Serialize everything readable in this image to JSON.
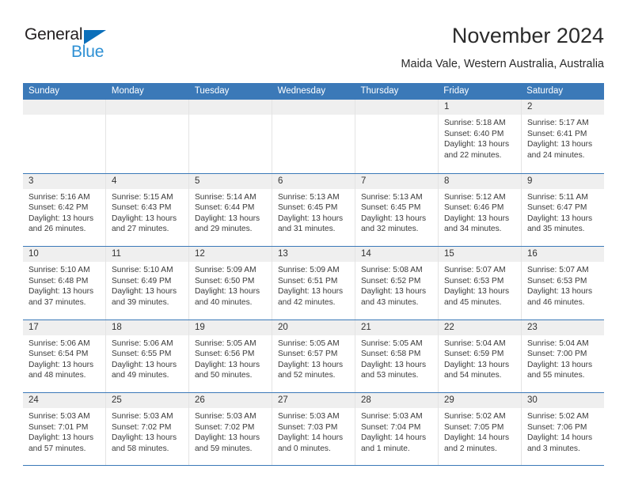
{
  "brand": {
    "name_part1": "General",
    "name_part2": "Blue",
    "triangle_color": "#0b6fba",
    "blue_color": "#2e90d4"
  },
  "header": {
    "title": "November 2024",
    "location": "Maida Vale, Western Australia, Australia"
  },
  "theme": {
    "header_blue": "#3b79b8",
    "day_band_gray": "#efefef",
    "text_color": "#3a3a3a"
  },
  "weekdays": [
    "Sunday",
    "Monday",
    "Tuesday",
    "Wednesday",
    "Thursday",
    "Friday",
    "Saturday"
  ],
  "weeks": [
    [
      {
        "day": "",
        "sunrise": "",
        "sunset": "",
        "daylight": "",
        "empty": true
      },
      {
        "day": "",
        "sunrise": "",
        "sunset": "",
        "daylight": "",
        "empty": true
      },
      {
        "day": "",
        "sunrise": "",
        "sunset": "",
        "daylight": "",
        "empty": true
      },
      {
        "day": "",
        "sunrise": "",
        "sunset": "",
        "daylight": "",
        "empty": true
      },
      {
        "day": "",
        "sunrise": "",
        "sunset": "",
        "daylight": "",
        "empty": true
      },
      {
        "day": "1",
        "sunrise": "Sunrise: 5:18 AM",
        "sunset": "Sunset: 6:40 PM",
        "daylight": "Daylight: 13 hours and 22 minutes."
      },
      {
        "day": "2",
        "sunrise": "Sunrise: 5:17 AM",
        "sunset": "Sunset: 6:41 PM",
        "daylight": "Daylight: 13 hours and 24 minutes."
      }
    ],
    [
      {
        "day": "3",
        "sunrise": "Sunrise: 5:16 AM",
        "sunset": "Sunset: 6:42 PM",
        "daylight": "Daylight: 13 hours and 26 minutes."
      },
      {
        "day": "4",
        "sunrise": "Sunrise: 5:15 AM",
        "sunset": "Sunset: 6:43 PM",
        "daylight": "Daylight: 13 hours and 27 minutes."
      },
      {
        "day": "5",
        "sunrise": "Sunrise: 5:14 AM",
        "sunset": "Sunset: 6:44 PM",
        "daylight": "Daylight: 13 hours and 29 minutes."
      },
      {
        "day": "6",
        "sunrise": "Sunrise: 5:13 AM",
        "sunset": "Sunset: 6:45 PM",
        "daylight": "Daylight: 13 hours and 31 minutes."
      },
      {
        "day": "7",
        "sunrise": "Sunrise: 5:13 AM",
        "sunset": "Sunset: 6:45 PM",
        "daylight": "Daylight: 13 hours and 32 minutes."
      },
      {
        "day": "8",
        "sunrise": "Sunrise: 5:12 AM",
        "sunset": "Sunset: 6:46 PM",
        "daylight": "Daylight: 13 hours and 34 minutes."
      },
      {
        "day": "9",
        "sunrise": "Sunrise: 5:11 AM",
        "sunset": "Sunset: 6:47 PM",
        "daylight": "Daylight: 13 hours and 35 minutes."
      }
    ],
    [
      {
        "day": "10",
        "sunrise": "Sunrise: 5:10 AM",
        "sunset": "Sunset: 6:48 PM",
        "daylight": "Daylight: 13 hours and 37 minutes."
      },
      {
        "day": "11",
        "sunrise": "Sunrise: 5:10 AM",
        "sunset": "Sunset: 6:49 PM",
        "daylight": "Daylight: 13 hours and 39 minutes."
      },
      {
        "day": "12",
        "sunrise": "Sunrise: 5:09 AM",
        "sunset": "Sunset: 6:50 PM",
        "daylight": "Daylight: 13 hours and 40 minutes."
      },
      {
        "day": "13",
        "sunrise": "Sunrise: 5:09 AM",
        "sunset": "Sunset: 6:51 PM",
        "daylight": "Daylight: 13 hours and 42 minutes."
      },
      {
        "day": "14",
        "sunrise": "Sunrise: 5:08 AM",
        "sunset": "Sunset: 6:52 PM",
        "daylight": "Daylight: 13 hours and 43 minutes."
      },
      {
        "day": "15",
        "sunrise": "Sunrise: 5:07 AM",
        "sunset": "Sunset: 6:53 PM",
        "daylight": "Daylight: 13 hours and 45 minutes."
      },
      {
        "day": "16",
        "sunrise": "Sunrise: 5:07 AM",
        "sunset": "Sunset: 6:53 PM",
        "daylight": "Daylight: 13 hours and 46 minutes."
      }
    ],
    [
      {
        "day": "17",
        "sunrise": "Sunrise: 5:06 AM",
        "sunset": "Sunset: 6:54 PM",
        "daylight": "Daylight: 13 hours and 48 minutes."
      },
      {
        "day": "18",
        "sunrise": "Sunrise: 5:06 AM",
        "sunset": "Sunset: 6:55 PM",
        "daylight": "Daylight: 13 hours and 49 minutes."
      },
      {
        "day": "19",
        "sunrise": "Sunrise: 5:05 AM",
        "sunset": "Sunset: 6:56 PM",
        "daylight": "Daylight: 13 hours and 50 minutes."
      },
      {
        "day": "20",
        "sunrise": "Sunrise: 5:05 AM",
        "sunset": "Sunset: 6:57 PM",
        "daylight": "Daylight: 13 hours and 52 minutes."
      },
      {
        "day": "21",
        "sunrise": "Sunrise: 5:05 AM",
        "sunset": "Sunset: 6:58 PM",
        "daylight": "Daylight: 13 hours and 53 minutes."
      },
      {
        "day": "22",
        "sunrise": "Sunrise: 5:04 AM",
        "sunset": "Sunset: 6:59 PM",
        "daylight": "Daylight: 13 hours and 54 minutes."
      },
      {
        "day": "23",
        "sunrise": "Sunrise: 5:04 AM",
        "sunset": "Sunset: 7:00 PM",
        "daylight": "Daylight: 13 hours and 55 minutes."
      }
    ],
    [
      {
        "day": "24",
        "sunrise": "Sunrise: 5:03 AM",
        "sunset": "Sunset: 7:01 PM",
        "daylight": "Daylight: 13 hours and 57 minutes."
      },
      {
        "day": "25",
        "sunrise": "Sunrise: 5:03 AM",
        "sunset": "Sunset: 7:02 PM",
        "daylight": "Daylight: 13 hours and 58 minutes."
      },
      {
        "day": "26",
        "sunrise": "Sunrise: 5:03 AM",
        "sunset": "Sunset: 7:02 PM",
        "daylight": "Daylight: 13 hours and 59 minutes."
      },
      {
        "day": "27",
        "sunrise": "Sunrise: 5:03 AM",
        "sunset": "Sunset: 7:03 PM",
        "daylight": "Daylight: 14 hours and 0 minutes."
      },
      {
        "day": "28",
        "sunrise": "Sunrise: 5:03 AM",
        "sunset": "Sunset: 7:04 PM",
        "daylight": "Daylight: 14 hours and 1 minute."
      },
      {
        "day": "29",
        "sunrise": "Sunrise: 5:02 AM",
        "sunset": "Sunset: 7:05 PM",
        "daylight": "Daylight: 14 hours and 2 minutes."
      },
      {
        "day": "30",
        "sunrise": "Sunrise: 5:02 AM",
        "sunset": "Sunset: 7:06 PM",
        "daylight": "Daylight: 14 hours and 3 minutes."
      }
    ]
  ]
}
